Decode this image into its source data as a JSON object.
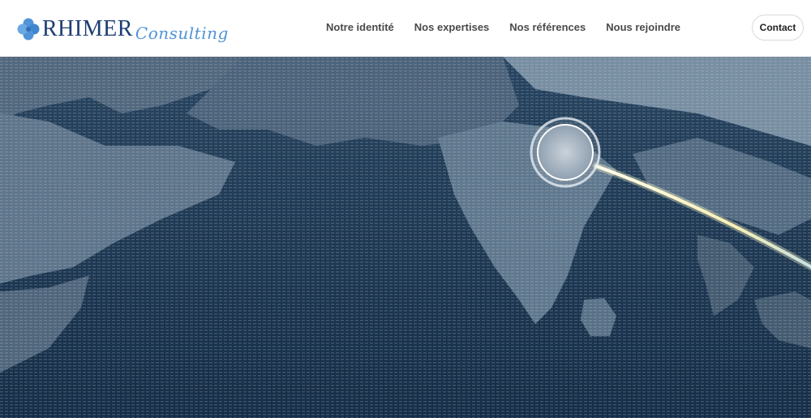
{
  "brand": {
    "name": "RHIMER",
    "tagline": "Consulting",
    "icon": "clover-icon"
  },
  "nav": {
    "items": [
      {
        "label": "Notre identité"
      },
      {
        "label": "Nos expertises"
      },
      {
        "label": "Nos références"
      },
      {
        "label": "Nous rejoindre"
      }
    ],
    "contact_label": "Contact"
  },
  "colors": {
    "brand_navy": "#1d3c74",
    "brand_blue": "#4f93d8",
    "ocean": "#1c3550",
    "route_glow": "#f4e9a0"
  }
}
